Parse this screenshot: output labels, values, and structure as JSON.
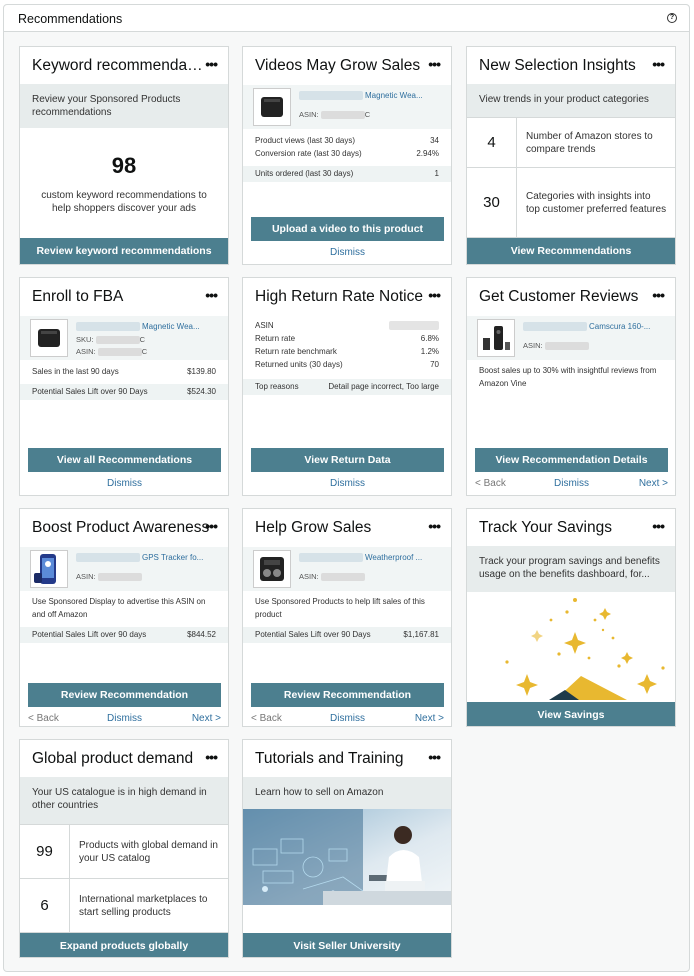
{
  "header": {
    "title": "Recommendations",
    "help_icon": "?"
  },
  "menu_glyph": "•••",
  "cards": {
    "keyword": {
      "title": "Keyword recommendations",
      "subtitle": "Review your Sponsored Products recommendations",
      "count": "98",
      "description": "custom keyword recommendations to help shoppers discover your ads",
      "button": "Review keyword recommendations"
    },
    "videos": {
      "title": "Videos May Grow Sales",
      "product_name": "Magnetic Wea...",
      "asin_label": "ASIN:",
      "asin_suffix": "C",
      "rows": [
        {
          "label": "Product views (last 30 days)",
          "value": "34"
        },
        {
          "label": "Conversion rate (last 30 days)",
          "value": "2.94%"
        },
        {
          "label": "Units ordered (last 30 days)",
          "value": "1"
        }
      ],
      "button": "Upload a video to this product",
      "dismiss": "Dismiss"
    },
    "selection": {
      "title": "New Selection Insights",
      "subtitle": "View trends in your product categories",
      "items": [
        {
          "num": "4",
          "text": "Number of Amazon stores to compare trends"
        },
        {
          "num": "30",
          "text": "Categories with insights into top customer preferred features"
        }
      ],
      "button": "View Recommendations"
    },
    "fba": {
      "title": "Enroll to FBA",
      "product_name": "Magnetic Wea...",
      "sku_label": "SKU:",
      "asin_label": "ASIN:",
      "code_suffix": "C",
      "rows": [
        {
          "label": "Sales in the last 90 days",
          "value": "$139.80"
        },
        {
          "label": "Potential Sales Lift over 90 Days",
          "value": "$524.30"
        }
      ],
      "button": "View all Recommendations",
      "dismiss": "Dismiss"
    },
    "returns": {
      "title": "High Return Rate Notice",
      "rows": [
        {
          "label": "ASIN",
          "value": ""
        },
        {
          "label": "Return rate",
          "value": "6.8%"
        },
        {
          "label": "Return rate benchmark",
          "value": "1.2%"
        },
        {
          "label": "Returned units (30 days)",
          "value": "70"
        }
      ],
      "reasons_label": "Top reasons",
      "reasons_value": "Detail page incorrect, Too large",
      "button": "View Return Data",
      "dismiss": "Dismiss"
    },
    "reviews": {
      "title": "Get Customer Reviews",
      "product_name": "Camscura 160-...",
      "asin_label": "ASIN:",
      "description": "Boost sales up to 30% with insightful reviews from Amazon Vine",
      "button": "View Recommendation Details",
      "back": "< Back",
      "dismiss": "Dismiss",
      "next": "Next >"
    },
    "awareness": {
      "title": "Boost Product Awareness",
      "product_name": "GPS Tracker fo...",
      "asin_label": "ASIN:",
      "description": "Use Sponsored Display to advertise this ASIN on and off Amazon",
      "lift_label": "Potential Sales Lift over 90 days",
      "lift_value": "$844.52",
      "button": "Review Recommendation",
      "back": "< Back",
      "dismiss": "Dismiss",
      "next": "Next >"
    },
    "grow": {
      "title": "Help Grow Sales",
      "product_name": "Weatherproof ...",
      "asin_label": "ASIN:",
      "description": "Use Sponsored Products to help lift sales of this product",
      "lift_label": "Potential Sales Lift over 90 Days",
      "lift_value": "$1,167.81",
      "button": "Review Recommendation",
      "back": "< Back",
      "dismiss": "Dismiss",
      "next": "Next >"
    },
    "savings": {
      "title": "Track Your Savings",
      "subtitle": "Track your program savings and benefits usage on the benefits dashboard, for...",
      "button": "View Savings"
    },
    "global": {
      "title": "Global product demand",
      "subtitle": "Your US catalogue is in high demand in other countries",
      "items": [
        {
          "num": "99",
          "text": "Products with global demand in your US catalog"
        },
        {
          "num": "6",
          "text": "International marketplaces to start selling products"
        }
      ],
      "button": "Expand products globally"
    },
    "tutorials": {
      "title": "Tutorials and Training",
      "subtitle": "Learn how to sell on Amazon",
      "button": "Visit Seller University"
    }
  },
  "colors": {
    "button": "#4c7f8f",
    "link": "#2f6f9e",
    "subtitle_bg": "#e7ecec",
    "sparkle": "#e8b830"
  }
}
